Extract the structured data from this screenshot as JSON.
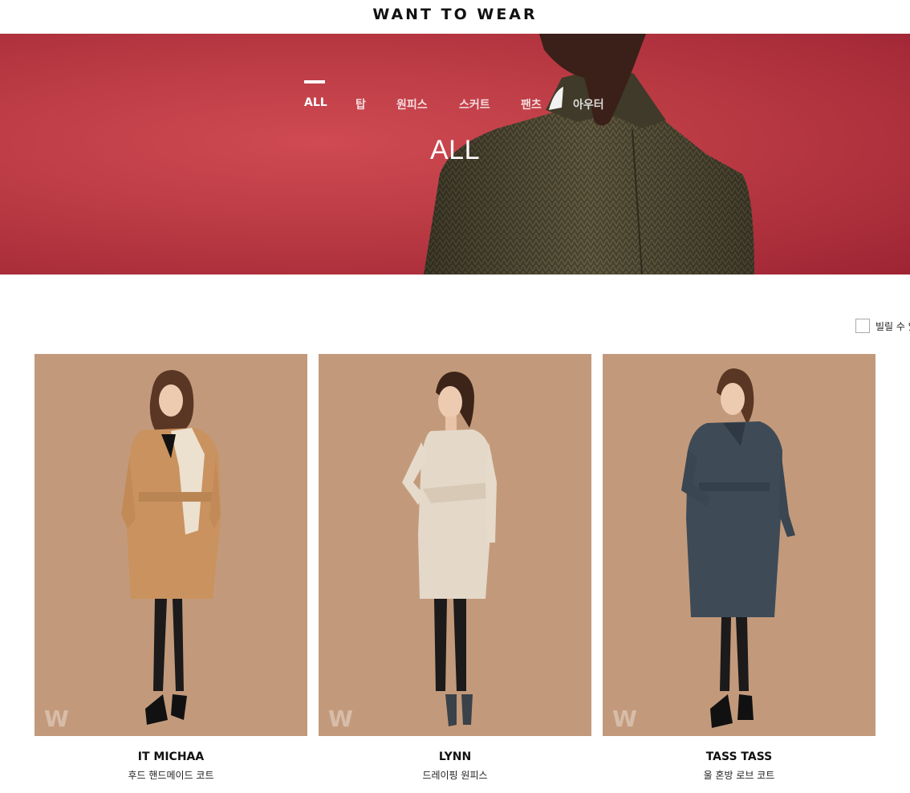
{
  "header": {
    "logo_text": "WANT TO WEAR"
  },
  "nav": {
    "items": [
      {
        "label": "ALL",
        "active": true
      },
      {
        "label": "탑",
        "active": false
      },
      {
        "label": "원피스",
        "active": false
      },
      {
        "label": "스커트",
        "active": false
      },
      {
        "label": "팬츠",
        "active": false
      },
      {
        "label": "아우터",
        "active": false
      }
    ]
  },
  "hero": {
    "title": "ALL"
  },
  "filter": {
    "label": "빌릴 수 있"
  },
  "products": [
    {
      "name": "IT MICHAA",
      "desc": "후드 핸드메이드 코트",
      "watermark": "W"
    },
    {
      "name": "LYNN",
      "desc": "드레이핑 원피스",
      "watermark": "W"
    },
    {
      "name": "TASS TASS",
      "desc": "울 혼방 로브 코트",
      "watermark": "W"
    }
  ],
  "colors": {
    "hero_red": "#bb3b44",
    "card_bg": "#c29a7b",
    "coat_olive": "#4a4330"
  }
}
